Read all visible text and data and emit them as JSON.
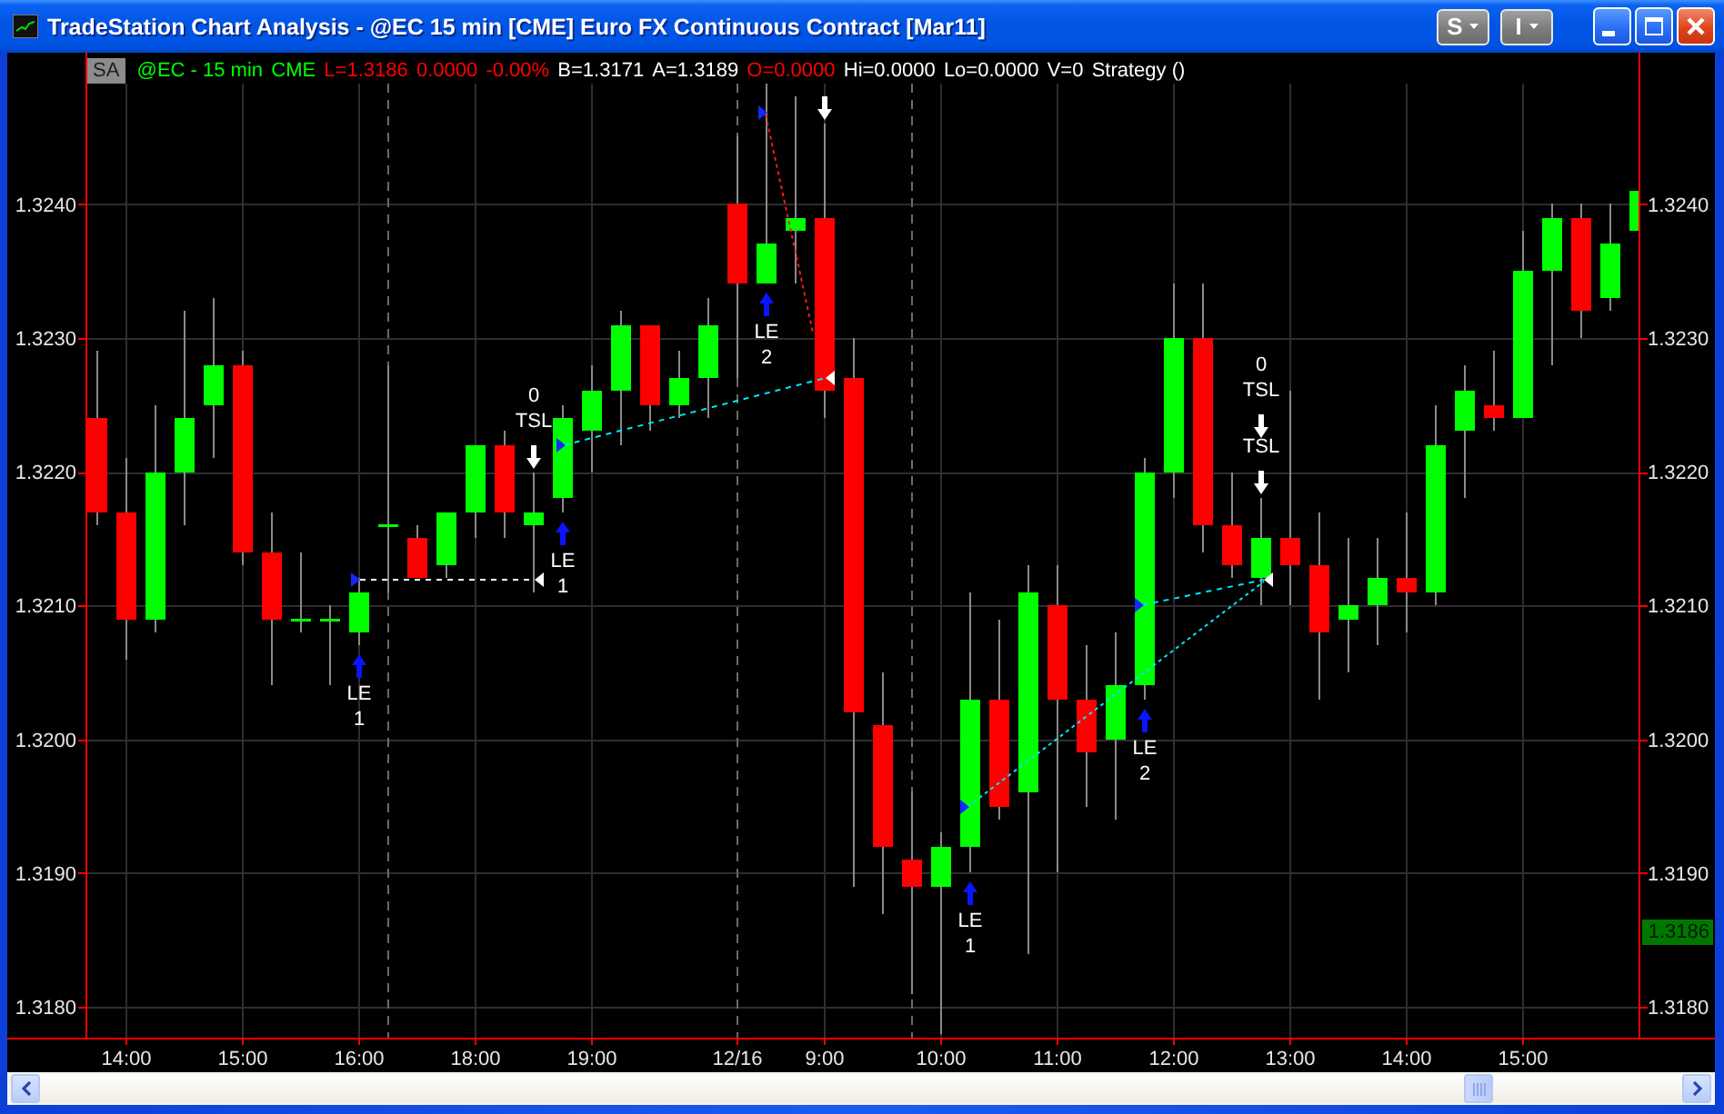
{
  "window": {
    "title": "TradeStation Chart Analysis - @EC 15 min [CME] Euro FX Continuous Contract [Mar11]",
    "menu_buttons": [
      {
        "label": "S"
      },
      {
        "label": "I"
      }
    ]
  },
  "info_bar": {
    "badge": "SA",
    "items": [
      {
        "text": "@EC - 15 min",
        "color": "#00ff00"
      },
      {
        "text": "CME",
        "color": "#00ff00"
      },
      {
        "text": "L=1.3186",
        "color": "#ff0000"
      },
      {
        "text": "0.0000",
        "color": "#ff0000"
      },
      {
        "text": "-0.00%",
        "color": "#ff0000"
      },
      {
        "text": "B=1.3171",
        "color": "#ffffff"
      },
      {
        "text": "A=1.3189",
        "color": "#ffffff"
      },
      {
        "text": "O=0.0000",
        "color": "#ff0000"
      },
      {
        "text": "Hi=0.0000",
        "color": "#ffffff"
      },
      {
        "text": "Lo=0.0000",
        "color": "#ffffff"
      },
      {
        "text": "V=0",
        "color": "#ffffff"
      },
      {
        "text": "Strategy ()",
        "color": "#ffffff"
      }
    ]
  },
  "chart": {
    "chart_data": {
      "type": "candlestick",
      "categories": [
        null,
        "14:00",
        null,
        null,
        null,
        "15:00",
        null,
        null,
        null,
        "16:00",
        null,
        null,
        null,
        "18:00",
        null,
        null,
        null,
        "19:00",
        null,
        null,
        null,
        null,
        "12/16",
        null,
        null,
        "9:00",
        null,
        null,
        null,
        "10:00",
        null,
        null,
        null,
        "11:00",
        null,
        null,
        null,
        "12:00",
        null,
        null,
        null,
        "13:00",
        null,
        null,
        null,
        "14:00",
        null,
        null,
        null,
        "15:00",
        null,
        null,
        null,
        null
      ],
      "ohlc": [
        [
          1.3224,
          1.3229,
          1.3216,
          1.3217
        ],
        [
          1.3217,
          1.3221,
          1.3206,
          1.3209
        ],
        [
          1.3209,
          1.3225,
          1.3208,
          1.322
        ],
        [
          1.322,
          1.3232,
          1.3216,
          1.3224
        ],
        [
          1.3225,
          1.3233,
          1.3221,
          1.3228
        ],
        [
          1.3228,
          1.3229,
          1.3213,
          1.3214
        ],
        [
          1.3214,
          1.3217,
          1.3204,
          1.3209
        ],
        [
          1.3209,
          1.3214,
          1.3208,
          1.3209
        ],
        [
          1.3209,
          1.321,
          1.3204,
          1.3209
        ],
        [
          1.3208,
          1.3212,
          1.3207,
          1.3211
        ],
        [
          1.3216,
          1.3228,
          1.3211,
          1.3216
        ],
        [
          1.3215,
          1.3216,
          1.3212,
          1.3212
        ],
        [
          1.3213,
          1.3217,
          1.3212,
          1.3217
        ],
        [
          1.3217,
          1.3222,
          1.3215,
          1.3222
        ],
        [
          1.3222,
          1.3223,
          1.3215,
          1.3217
        ],
        [
          1.3216,
          1.322,
          1.3211,
          1.3217
        ],
        [
          1.3218,
          1.3225,
          1.3217,
          1.3224
        ],
        [
          1.3223,
          1.3228,
          1.322,
          1.3226
        ],
        [
          1.3226,
          1.3232,
          1.3222,
          1.3231
        ],
        [
          1.3231,
          1.3231,
          1.3223,
          1.3225
        ],
        [
          1.3225,
          1.3229,
          1.3224,
          1.3227
        ],
        [
          1.3227,
          1.3233,
          1.3224,
          1.3231
        ],
        [
          1.324,
          1.3245,
          1.3227,
          1.3234
        ],
        [
          1.3234,
          1.3249,
          1.3234,
          1.3237
        ],
        [
          1.3238,
          1.3248,
          1.3234,
          1.3239
        ],
        [
          1.3239,
          1.3246,
          1.3224,
          1.3226
        ],
        [
          1.3227,
          1.323,
          1.3189,
          1.3202
        ],
        [
          1.3201,
          1.3205,
          1.3187,
          1.3192
        ],
        [
          1.3191,
          1.3196,
          1.3181,
          1.3189
        ],
        [
          1.3189,
          1.3193,
          1.3178,
          1.3192
        ],
        [
          1.3192,
          1.3211,
          1.319,
          1.3203
        ],
        [
          1.3203,
          1.3209,
          1.3194,
          1.3195
        ],
        [
          1.3196,
          1.3213,
          1.3184,
          1.3211
        ],
        [
          1.321,
          1.3213,
          1.319,
          1.3203
        ],
        [
          1.3203,
          1.3207,
          1.3195,
          1.3199
        ],
        [
          1.32,
          1.3208,
          1.3194,
          1.3204
        ],
        [
          1.3204,
          1.3221,
          1.3203,
          1.322
        ],
        [
          1.322,
          1.3234,
          1.3218,
          1.323
        ],
        [
          1.323,
          1.3234,
          1.3214,
          1.3216
        ],
        [
          1.3216,
          1.322,
          1.3212,
          1.3213
        ],
        [
          1.3212,
          1.3218,
          1.321,
          1.3215
        ],
        [
          1.3215,
          1.3226,
          1.321,
          1.3213
        ],
        [
          1.3213,
          1.3217,
          1.3203,
          1.3208
        ],
        [
          1.3209,
          1.3215,
          1.3205,
          1.321
        ],
        [
          1.321,
          1.3215,
          1.3207,
          1.3212
        ],
        [
          1.3212,
          1.3217,
          1.3208,
          1.3211
        ],
        [
          1.3211,
          1.3225,
          1.321,
          1.3222
        ],
        [
          1.3223,
          1.3228,
          1.3218,
          1.3226
        ],
        [
          1.3225,
          1.3229,
          1.3223,
          1.3224
        ],
        [
          1.3224,
          1.3238,
          1.3224,
          1.3235
        ],
        [
          1.3235,
          1.324,
          1.3228,
          1.3239
        ],
        [
          1.3239,
          1.324,
          1.323,
          1.3232
        ],
        [
          1.3233,
          1.324,
          1.3232,
          1.3237
        ],
        [
          1.3238,
          1.3241,
          1.3238,
          1.3241
        ]
      ],
      "ylim": [
        1.31777,
        1.3249
      ],
      "yticks": [
        {
          "value": 1.324,
          "label": "1.3240"
        },
        {
          "value": 1.323,
          "label": "1.3230"
        },
        {
          "value": 1.322,
          "label": "1.3220"
        },
        {
          "value": 1.321,
          "label": "1.3210"
        },
        {
          "value": 1.32,
          "label": "1.3200"
        },
        {
          "value": 1.319,
          "label": "1.3190"
        },
        {
          "value": 1.318,
          "label": "1.3180"
        }
      ],
      "grid": true
    },
    "right_axis_labels": [
      "1.3240",
      "1.3230",
      "1.3220",
      "1.3210",
      "1.3200",
      "1.3190",
      "1.3180"
    ],
    "last_price": "1.3186",
    "signals": [
      {
        "kind": "long_entry",
        "label": "LE",
        "count": "1"
      },
      {
        "kind": "exit",
        "count": "0",
        "label": "TSL"
      },
      {
        "kind": "long_entry",
        "label": "LE",
        "count": "1"
      },
      {
        "kind": "long_entry",
        "label": "LE",
        "count": "2"
      },
      {
        "kind": "exit"
      },
      {
        "kind": "long_entry",
        "label": "LE",
        "count": "1"
      },
      {
        "kind": "long_entry",
        "label": "LE",
        "count": "2"
      },
      {
        "kind": "exit",
        "count": "0",
        "label": "TSL"
      },
      {
        "kind": "exit",
        "label": "TSL"
      }
    ]
  }
}
